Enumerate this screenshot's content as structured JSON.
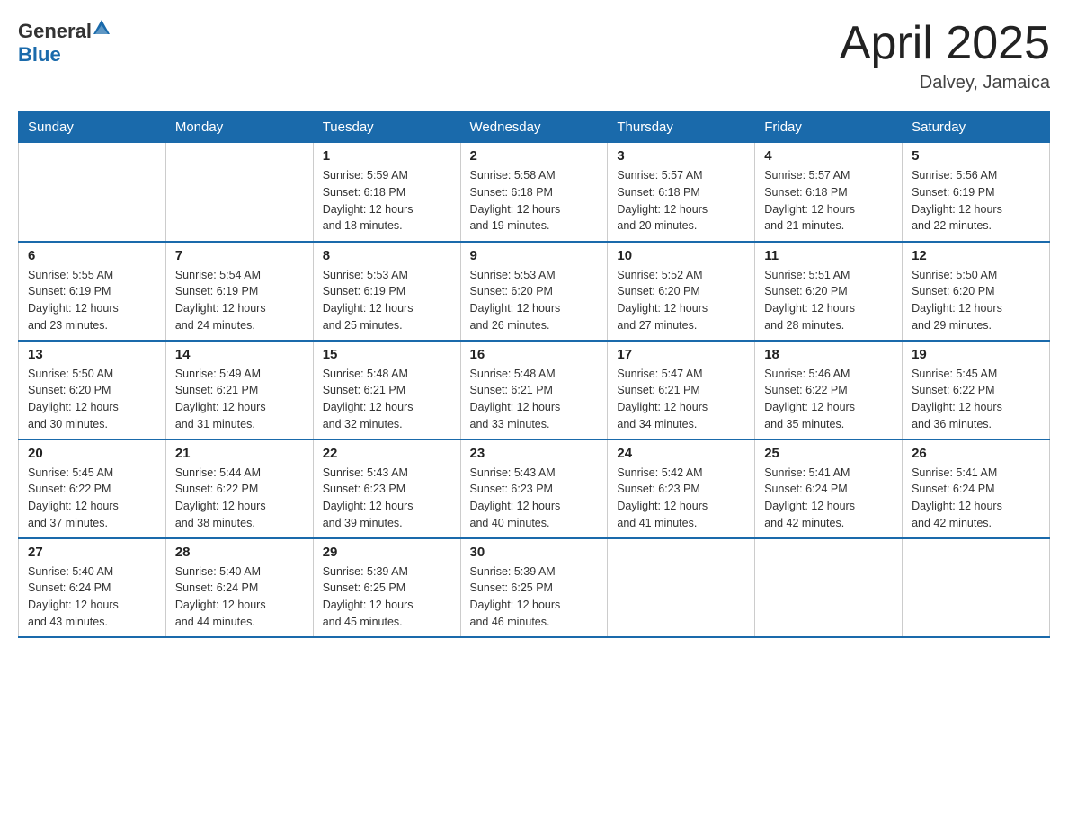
{
  "header": {
    "logo_general": "General",
    "logo_blue": "Blue",
    "title": "April 2025",
    "subtitle": "Dalvey, Jamaica"
  },
  "weekdays": [
    "Sunday",
    "Monday",
    "Tuesday",
    "Wednesday",
    "Thursday",
    "Friday",
    "Saturday"
  ],
  "weeks": [
    [
      {
        "day": "",
        "info": ""
      },
      {
        "day": "",
        "info": ""
      },
      {
        "day": "1",
        "info": "Sunrise: 5:59 AM\nSunset: 6:18 PM\nDaylight: 12 hours\nand 18 minutes."
      },
      {
        "day": "2",
        "info": "Sunrise: 5:58 AM\nSunset: 6:18 PM\nDaylight: 12 hours\nand 19 minutes."
      },
      {
        "day": "3",
        "info": "Sunrise: 5:57 AM\nSunset: 6:18 PM\nDaylight: 12 hours\nand 20 minutes."
      },
      {
        "day": "4",
        "info": "Sunrise: 5:57 AM\nSunset: 6:18 PM\nDaylight: 12 hours\nand 21 minutes."
      },
      {
        "day": "5",
        "info": "Sunrise: 5:56 AM\nSunset: 6:19 PM\nDaylight: 12 hours\nand 22 minutes."
      }
    ],
    [
      {
        "day": "6",
        "info": "Sunrise: 5:55 AM\nSunset: 6:19 PM\nDaylight: 12 hours\nand 23 minutes."
      },
      {
        "day": "7",
        "info": "Sunrise: 5:54 AM\nSunset: 6:19 PM\nDaylight: 12 hours\nand 24 minutes."
      },
      {
        "day": "8",
        "info": "Sunrise: 5:53 AM\nSunset: 6:19 PM\nDaylight: 12 hours\nand 25 minutes."
      },
      {
        "day": "9",
        "info": "Sunrise: 5:53 AM\nSunset: 6:20 PM\nDaylight: 12 hours\nand 26 minutes."
      },
      {
        "day": "10",
        "info": "Sunrise: 5:52 AM\nSunset: 6:20 PM\nDaylight: 12 hours\nand 27 minutes."
      },
      {
        "day": "11",
        "info": "Sunrise: 5:51 AM\nSunset: 6:20 PM\nDaylight: 12 hours\nand 28 minutes."
      },
      {
        "day": "12",
        "info": "Sunrise: 5:50 AM\nSunset: 6:20 PM\nDaylight: 12 hours\nand 29 minutes."
      }
    ],
    [
      {
        "day": "13",
        "info": "Sunrise: 5:50 AM\nSunset: 6:20 PM\nDaylight: 12 hours\nand 30 minutes."
      },
      {
        "day": "14",
        "info": "Sunrise: 5:49 AM\nSunset: 6:21 PM\nDaylight: 12 hours\nand 31 minutes."
      },
      {
        "day": "15",
        "info": "Sunrise: 5:48 AM\nSunset: 6:21 PM\nDaylight: 12 hours\nand 32 minutes."
      },
      {
        "day": "16",
        "info": "Sunrise: 5:48 AM\nSunset: 6:21 PM\nDaylight: 12 hours\nand 33 minutes."
      },
      {
        "day": "17",
        "info": "Sunrise: 5:47 AM\nSunset: 6:21 PM\nDaylight: 12 hours\nand 34 minutes."
      },
      {
        "day": "18",
        "info": "Sunrise: 5:46 AM\nSunset: 6:22 PM\nDaylight: 12 hours\nand 35 minutes."
      },
      {
        "day": "19",
        "info": "Sunrise: 5:45 AM\nSunset: 6:22 PM\nDaylight: 12 hours\nand 36 minutes."
      }
    ],
    [
      {
        "day": "20",
        "info": "Sunrise: 5:45 AM\nSunset: 6:22 PM\nDaylight: 12 hours\nand 37 minutes."
      },
      {
        "day": "21",
        "info": "Sunrise: 5:44 AM\nSunset: 6:22 PM\nDaylight: 12 hours\nand 38 minutes."
      },
      {
        "day": "22",
        "info": "Sunrise: 5:43 AM\nSunset: 6:23 PM\nDaylight: 12 hours\nand 39 minutes."
      },
      {
        "day": "23",
        "info": "Sunrise: 5:43 AM\nSunset: 6:23 PM\nDaylight: 12 hours\nand 40 minutes."
      },
      {
        "day": "24",
        "info": "Sunrise: 5:42 AM\nSunset: 6:23 PM\nDaylight: 12 hours\nand 41 minutes."
      },
      {
        "day": "25",
        "info": "Sunrise: 5:41 AM\nSunset: 6:24 PM\nDaylight: 12 hours\nand 42 minutes."
      },
      {
        "day": "26",
        "info": "Sunrise: 5:41 AM\nSunset: 6:24 PM\nDaylight: 12 hours\nand 42 minutes."
      }
    ],
    [
      {
        "day": "27",
        "info": "Sunrise: 5:40 AM\nSunset: 6:24 PM\nDaylight: 12 hours\nand 43 minutes."
      },
      {
        "day": "28",
        "info": "Sunrise: 5:40 AM\nSunset: 6:24 PM\nDaylight: 12 hours\nand 44 minutes."
      },
      {
        "day": "29",
        "info": "Sunrise: 5:39 AM\nSunset: 6:25 PM\nDaylight: 12 hours\nand 45 minutes."
      },
      {
        "day": "30",
        "info": "Sunrise: 5:39 AM\nSunset: 6:25 PM\nDaylight: 12 hours\nand 46 minutes."
      },
      {
        "day": "",
        "info": ""
      },
      {
        "day": "",
        "info": ""
      },
      {
        "day": "",
        "info": ""
      }
    ]
  ]
}
